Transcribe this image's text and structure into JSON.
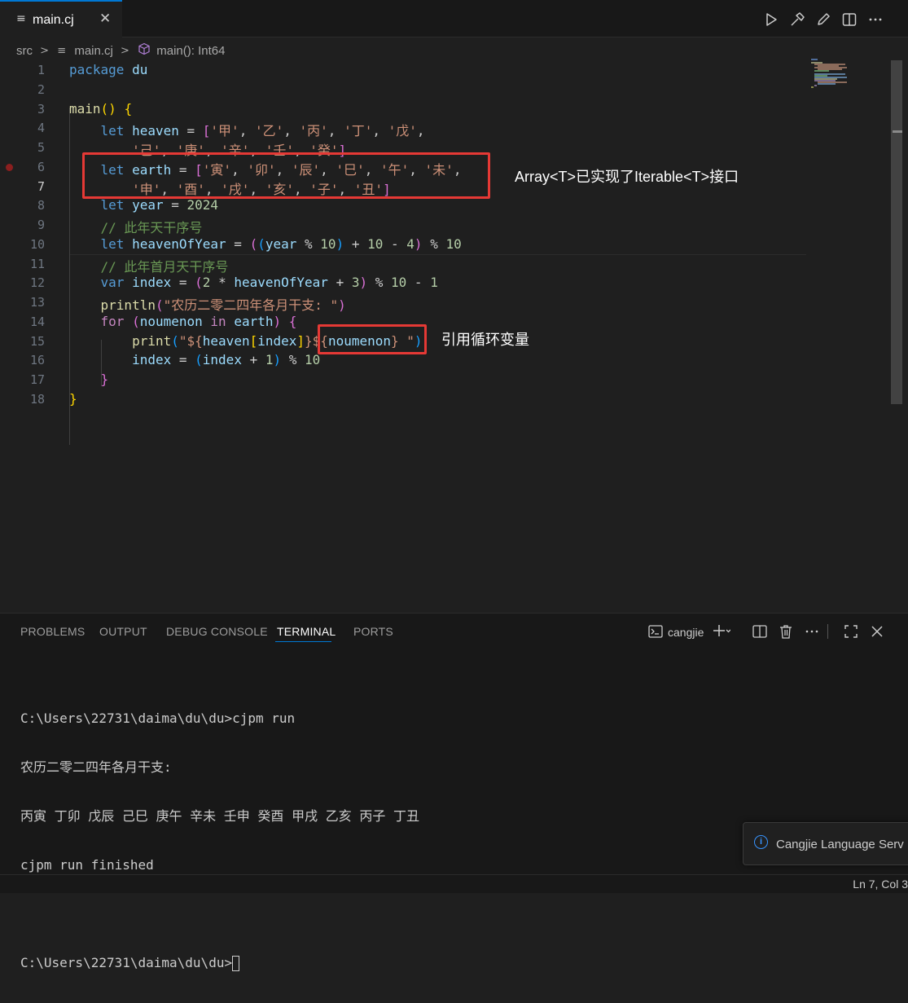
{
  "tab": {
    "icon": "≡",
    "label": "main.cj",
    "close": "✕"
  },
  "editor_actions": [
    "run-icon",
    "build-icon",
    "edit-icon",
    "split-editor-icon",
    "more-icon"
  ],
  "breadcrumb": {
    "folder": "src",
    "file_icon": "≡",
    "file": "main.cj",
    "symbol": "main(): Int64"
  },
  "code": {
    "line_numbers": [
      "1",
      "2",
      "3",
      "4",
      "5",
      "6",
      "7",
      "8",
      "9",
      "10",
      "11",
      "12",
      "13",
      "14",
      "15",
      "16",
      "17",
      "18"
    ],
    "l1_kw": "package",
    "l1_name": "du",
    "l3_fn": "main",
    "l3_rest": "() {",
    "l4_kw": "let",
    "l4_var": "heaven",
    "l4_eq": " = ",
    "l4_items": [
      "'甲'",
      "'乙'",
      "'丙'",
      "'丁'",
      "'戊'"
    ],
    "l5_items": [
      "'己'",
      "'庚'",
      "'辛'",
      "'壬'",
      "'癸'"
    ],
    "l6_kw": "let",
    "l6_var": "earth",
    "l6_eq": " = ",
    "l6_items": [
      "'寅'",
      "'卯'",
      "'辰'",
      "'巳'",
      "'午'",
      "'未'"
    ],
    "l7_items": [
      "'申'",
      "'酉'",
      "'戌'",
      "'亥'",
      "'子'",
      "'丑'"
    ],
    "l8_kw": "let",
    "l8_var": "year",
    "l8_eq": " = ",
    "l8_num": "2024",
    "l9_comment": "// 此年天干序号",
    "l10_kw": "let",
    "l10_var": "heavenOfYear",
    "l10_eq": " = ",
    "l10_var2": "year",
    "l10_op1": " % ",
    "l10_n1": "10",
    "l10_op2": " + ",
    "l10_n2": "10",
    "l10_op3": " - ",
    "l10_n3": "4",
    "l10_op4": " % ",
    "l10_n4": "10",
    "l11_comment": "// 此年首月天干序号",
    "l12_kw": "var",
    "l12_var": "index",
    "l12_eq": " = ",
    "l12_n1": "2",
    "l12_op1": " * ",
    "l12_var2": "heavenOfYear",
    "l12_op2": " + ",
    "l12_n2": "3",
    "l12_op3": " % ",
    "l12_n3": "10",
    "l12_op4": " - ",
    "l12_n4": "1",
    "l13_fn": "println",
    "l13_str": "\"农历二零二四年各月干支: \"",
    "l14_kw": "for",
    "l14_var": "noumenon",
    "l14_in": "in",
    "l14_var2": "earth",
    "l15_fn": "print",
    "l15_s1": "\"${",
    "l15_v1": "heaven",
    "l15_v2": "index",
    "l15_s2": "}${",
    "l15_v3": "noumenon",
    "l15_s3": "} \"",
    "l16_var": "index",
    "l16_eq": " = ",
    "l16_var2": "index",
    "l16_op1": " + ",
    "l16_n1": "1",
    "l16_op2": " % ",
    "l16_n2": "10",
    "l17": "}",
    "l18": "}"
  },
  "annotations": {
    "iterable_note": "Array<T>已实现了Iterable<T>接口",
    "loop_var_note": "引用循环变量"
  },
  "panel": {
    "tabs": [
      "PROBLEMS",
      "OUTPUT",
      "DEBUG CONSOLE",
      "TERMINAL",
      "PORTS"
    ],
    "active_tab": "TERMINAL",
    "terminal_name": "cangjie",
    "terminal_lines": [
      "C:\\Users\\22731\\daima\\du\\du>cjpm run",
      "农历二零二四年各月干支:",
      "丙寅 丁卯 戊辰 己巳 庚午 辛未 壬申 癸酉 甲戌 乙亥 丙子 丁丑",
      "cjpm run finished",
      "",
      "C:\\Users\\22731\\daima\\du\\du>"
    ]
  },
  "notification": {
    "text": "Cangjie Language Serv"
  },
  "status": {
    "position": "Ln 7, Col 3"
  }
}
